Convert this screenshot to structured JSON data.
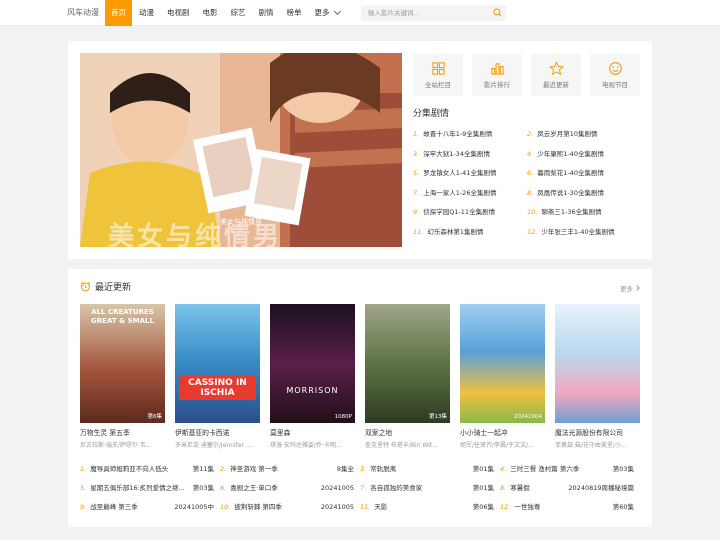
{
  "header": {
    "logo": "风车动漫",
    "nav": [
      "首页",
      "动漫",
      "电视剧",
      "电影",
      "综艺",
      "剧情",
      "榜单"
    ],
    "more": "更多",
    "search_placeholder": "输入影片关键词..."
  },
  "banner": {
    "caption": "美女与纯情男",
    "bigtext": "美女与纯情男"
  },
  "quick_links": [
    {
      "label": "全站栏目",
      "icon": "grid-icon"
    },
    {
      "label": "影片排行",
      "icon": "bar-chart-icon"
    },
    {
      "label": "最近更新",
      "icon": "star-icon"
    },
    {
      "label": "电视节目",
      "icon": "smile-icon"
    }
  ],
  "episodes": {
    "title": "分集剧情",
    "items": [
      {
        "num": "1.",
        "text": "故晋十八年1-9全集剧情"
      },
      {
        "num": "2.",
        "text": "凤云岁月第10集剧情"
      },
      {
        "num": "3.",
        "text": "深牢大狱1-34全集剧情"
      },
      {
        "num": "4.",
        "text": "少年康熙1-40全集剧情"
      },
      {
        "num": "5.",
        "text": "罗龙镇女人1-41全集剧情"
      },
      {
        "num": "6.",
        "text": "暮雨梨花1-40全集剧情"
      },
      {
        "num": "7.",
        "text": "上海一家人1-26全集剧情"
      },
      {
        "num": "8.",
        "text": "凤凰传说1-30全集剧情"
      },
      {
        "num": "9.",
        "text": "侦探学园Q1-11全集剧情"
      },
      {
        "num": "10.",
        "text": "聊斋三1-36全集剧情"
      },
      {
        "num": "11.",
        "text": "幻乐森林第1集剧情"
      },
      {
        "num": "12.",
        "text": "少年张三丰1-40全集剧情"
      }
    ]
  },
  "recent": {
    "title": "最近更新",
    "more": "更多",
    "posters": [
      {
        "title": "万物生灵 第五季",
        "cast": "尼古拉斯·瑞夫/萨缪尔·韦...",
        "badge": "第6集",
        "ptext": "ALL CREATURES GREAT & SMALL",
        "bg": "#8a3b2c"
      },
      {
        "title": "伊斯基亚的卡西诺",
        "cast": "多米尼克·迪塞尔/Jennifer ...",
        "badge": "",
        "ptext": "CASSINO IN ISCHIA",
        "bg": "#3a8fc8"
      },
      {
        "title": "莫里森",
        "cast": "琪洛·安玛达雅姿/乔·卡明...",
        "badge": "1080P",
        "ptext": "MORRISON",
        "bg": "#3b1d36"
      },
      {
        "title": "双案之地",
        "cast": "查克里特·布塔辛/Bin Wit...",
        "badge": "第13集",
        "ptext": "",
        "bg": "#4f6a3a"
      },
      {
        "title": "小小骑士一起冲",
        "cast": "胡军/任贤齐/李晨/于文文/...",
        "badge": "20241004",
        "ptext": "",
        "bg": "#5aa0d8"
      },
      {
        "title": "魔法光源股份有限公司",
        "cast": "菲奥兹·菇/花守由美里/小...",
        "badge": "",
        "ptext": "",
        "bg": "#b9d9f0"
      }
    ],
    "list": [
      {
        "num": "1.",
        "name": "魔导具师妲莉亚不向人低头",
        "status": "第11集"
      },
      {
        "num": "2.",
        "name": "神圣游戏 第一季",
        "status": "8集全"
      },
      {
        "num": "3.",
        "name": "常轨脱离",
        "status": "第01集"
      },
      {
        "num": "4.",
        "name": "三时三餐 渔村篇 第六季",
        "status": "第03集"
      },
      {
        "num": "5.",
        "name": "星期五俱乐部16:炙烈爱情之继...",
        "status": "第03集"
      },
      {
        "num": "6.",
        "name": "喜剧之王·单口季",
        "status": "20241005"
      },
      {
        "num": "7.",
        "name": "各自孤独的美食家",
        "status": "第01集"
      },
      {
        "num": "8.",
        "name": "寒暑假",
        "status": "20240819周播秘境篇"
      },
      {
        "num": "9.",
        "name": "战至巅峰 第三季",
        "status": "20241005中"
      },
      {
        "num": "10.",
        "name": "披荆斩棘 第四季",
        "status": "20241005"
      },
      {
        "num": "11.",
        "name": "天影",
        "status": "第06集"
      },
      {
        "num": "12.",
        "name": "一世独尊",
        "status": "第60集"
      }
    ]
  },
  "colors": {
    "accent": "#ff9900",
    "num": "#f39800"
  }
}
